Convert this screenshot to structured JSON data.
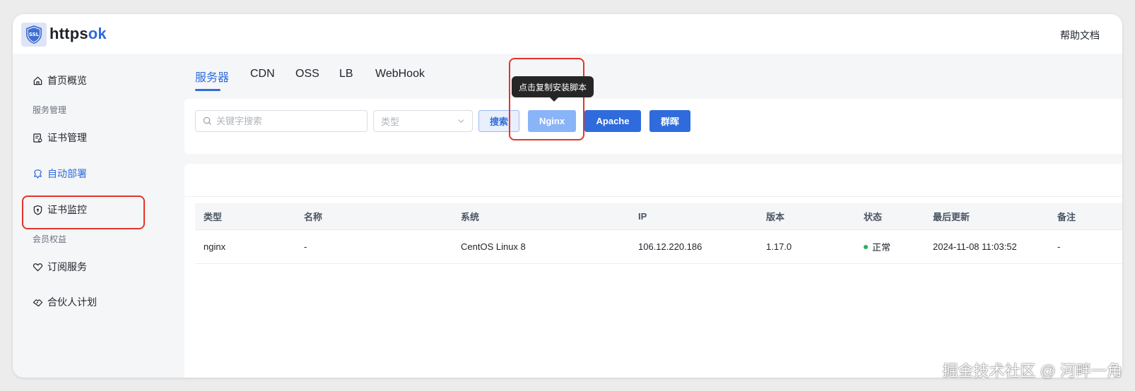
{
  "header": {
    "brand_prefix": "https",
    "brand_suffix": "ok",
    "logo_text": "SSL",
    "help_link": "帮助文档"
  },
  "sidebar": {
    "items": [
      {
        "label": "首页概览",
        "icon": "home-icon"
      },
      {
        "group": "服务管理"
      },
      {
        "label": "证书管理",
        "icon": "certificate-icon"
      },
      {
        "label": "自动部署",
        "icon": "deploy-icon",
        "active": true
      },
      {
        "label": "证书监控",
        "icon": "shield-icon"
      },
      {
        "group": "会员权益"
      },
      {
        "label": "订阅服务",
        "icon": "heart-icon"
      },
      {
        "label": "合伙人计划",
        "icon": "handshake-icon"
      }
    ]
  },
  "tabs": [
    {
      "label": "服务器",
      "active": true
    },
    {
      "label": "CDN"
    },
    {
      "label": "OSS"
    },
    {
      "label": "LB"
    },
    {
      "label": "WebHook"
    }
  ],
  "toolbar": {
    "search_placeholder": "关键字搜索",
    "type_placeholder": "类型",
    "search_button": "搜索",
    "nginx_button": "Nginx",
    "apache_button": "Apache",
    "synology_button": "群晖",
    "tooltip": "点击复制安装脚本"
  },
  "table": {
    "columns": [
      "类型",
      "名称",
      "系统",
      "IP",
      "版本",
      "状态",
      "最后更新",
      "备注"
    ],
    "rows": [
      {
        "type": "nginx",
        "name": "-",
        "system": "CentOS Linux 8",
        "ip": "106.12.220.186",
        "version": "1.17.0",
        "status": "正常",
        "updated": "2024-11-08 11:03:52",
        "note": "-"
      }
    ]
  },
  "colors": {
    "accent": "#2f6bdc",
    "highlight_frame": "#e5332a",
    "status_ok": "#22b35e"
  },
  "watermark": "掘金技术社区 @ 河畔一角"
}
